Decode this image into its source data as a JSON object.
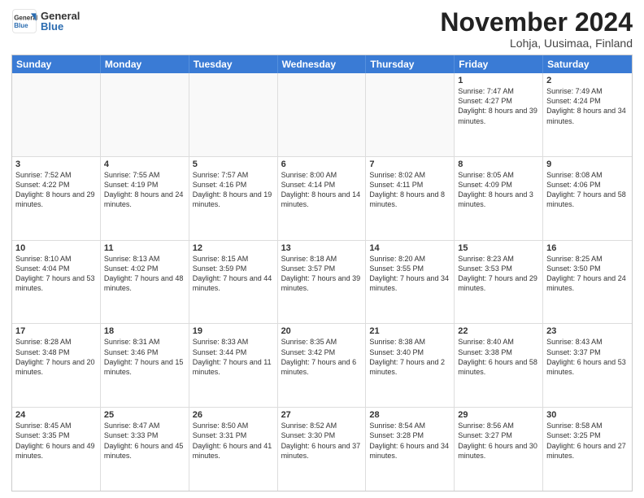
{
  "logo": {
    "general": "General",
    "blue": "Blue"
  },
  "title": "November 2024",
  "location": "Lohja, Uusimaa, Finland",
  "header_days": [
    "Sunday",
    "Monday",
    "Tuesday",
    "Wednesday",
    "Thursday",
    "Friday",
    "Saturday"
  ],
  "weeks": [
    [
      {
        "day": "",
        "info": ""
      },
      {
        "day": "",
        "info": ""
      },
      {
        "day": "",
        "info": ""
      },
      {
        "day": "",
        "info": ""
      },
      {
        "day": "",
        "info": ""
      },
      {
        "day": "1",
        "info": "Sunrise: 7:47 AM\nSunset: 4:27 PM\nDaylight: 8 hours and 39 minutes."
      },
      {
        "day": "2",
        "info": "Sunrise: 7:49 AM\nSunset: 4:24 PM\nDaylight: 8 hours and 34 minutes."
      }
    ],
    [
      {
        "day": "3",
        "info": "Sunrise: 7:52 AM\nSunset: 4:22 PM\nDaylight: 8 hours and 29 minutes."
      },
      {
        "day": "4",
        "info": "Sunrise: 7:55 AM\nSunset: 4:19 PM\nDaylight: 8 hours and 24 minutes."
      },
      {
        "day": "5",
        "info": "Sunrise: 7:57 AM\nSunset: 4:16 PM\nDaylight: 8 hours and 19 minutes."
      },
      {
        "day": "6",
        "info": "Sunrise: 8:00 AM\nSunset: 4:14 PM\nDaylight: 8 hours and 14 minutes."
      },
      {
        "day": "7",
        "info": "Sunrise: 8:02 AM\nSunset: 4:11 PM\nDaylight: 8 hours and 8 minutes."
      },
      {
        "day": "8",
        "info": "Sunrise: 8:05 AM\nSunset: 4:09 PM\nDaylight: 8 hours and 3 minutes."
      },
      {
        "day": "9",
        "info": "Sunrise: 8:08 AM\nSunset: 4:06 PM\nDaylight: 7 hours and 58 minutes."
      }
    ],
    [
      {
        "day": "10",
        "info": "Sunrise: 8:10 AM\nSunset: 4:04 PM\nDaylight: 7 hours and 53 minutes."
      },
      {
        "day": "11",
        "info": "Sunrise: 8:13 AM\nSunset: 4:02 PM\nDaylight: 7 hours and 48 minutes."
      },
      {
        "day": "12",
        "info": "Sunrise: 8:15 AM\nSunset: 3:59 PM\nDaylight: 7 hours and 44 minutes."
      },
      {
        "day": "13",
        "info": "Sunrise: 8:18 AM\nSunset: 3:57 PM\nDaylight: 7 hours and 39 minutes."
      },
      {
        "day": "14",
        "info": "Sunrise: 8:20 AM\nSunset: 3:55 PM\nDaylight: 7 hours and 34 minutes."
      },
      {
        "day": "15",
        "info": "Sunrise: 8:23 AM\nSunset: 3:53 PM\nDaylight: 7 hours and 29 minutes."
      },
      {
        "day": "16",
        "info": "Sunrise: 8:25 AM\nSunset: 3:50 PM\nDaylight: 7 hours and 24 minutes."
      }
    ],
    [
      {
        "day": "17",
        "info": "Sunrise: 8:28 AM\nSunset: 3:48 PM\nDaylight: 7 hours and 20 minutes."
      },
      {
        "day": "18",
        "info": "Sunrise: 8:31 AM\nSunset: 3:46 PM\nDaylight: 7 hours and 15 minutes."
      },
      {
        "day": "19",
        "info": "Sunrise: 8:33 AM\nSunset: 3:44 PM\nDaylight: 7 hours and 11 minutes."
      },
      {
        "day": "20",
        "info": "Sunrise: 8:35 AM\nSunset: 3:42 PM\nDaylight: 7 hours and 6 minutes."
      },
      {
        "day": "21",
        "info": "Sunrise: 8:38 AM\nSunset: 3:40 PM\nDaylight: 7 hours and 2 minutes."
      },
      {
        "day": "22",
        "info": "Sunrise: 8:40 AM\nSunset: 3:38 PM\nDaylight: 6 hours and 58 minutes."
      },
      {
        "day": "23",
        "info": "Sunrise: 8:43 AM\nSunset: 3:37 PM\nDaylight: 6 hours and 53 minutes."
      }
    ],
    [
      {
        "day": "24",
        "info": "Sunrise: 8:45 AM\nSunset: 3:35 PM\nDaylight: 6 hours and 49 minutes."
      },
      {
        "day": "25",
        "info": "Sunrise: 8:47 AM\nSunset: 3:33 PM\nDaylight: 6 hours and 45 minutes."
      },
      {
        "day": "26",
        "info": "Sunrise: 8:50 AM\nSunset: 3:31 PM\nDaylight: 6 hours and 41 minutes."
      },
      {
        "day": "27",
        "info": "Sunrise: 8:52 AM\nSunset: 3:30 PM\nDaylight: 6 hours and 37 minutes."
      },
      {
        "day": "28",
        "info": "Sunrise: 8:54 AM\nSunset: 3:28 PM\nDaylight: 6 hours and 34 minutes."
      },
      {
        "day": "29",
        "info": "Sunrise: 8:56 AM\nSunset: 3:27 PM\nDaylight: 6 hours and 30 minutes."
      },
      {
        "day": "30",
        "info": "Sunrise: 8:58 AM\nSunset: 3:25 PM\nDaylight: 6 hours and 27 minutes."
      }
    ]
  ]
}
